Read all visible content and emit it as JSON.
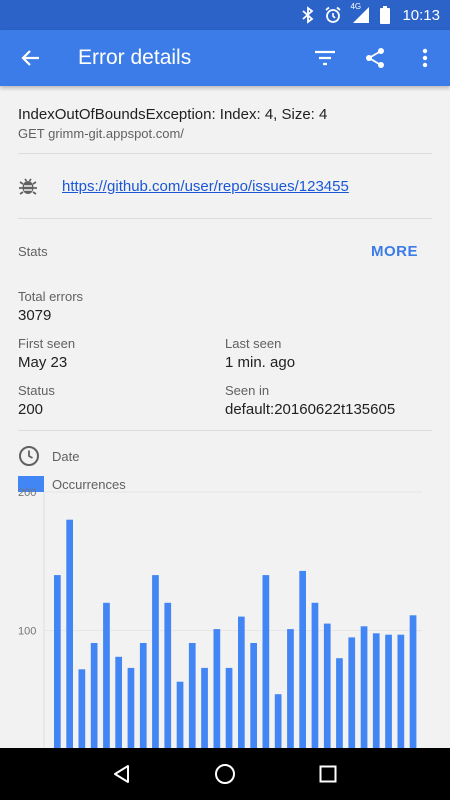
{
  "status_bar": {
    "time": "10:13",
    "network_label": "4G",
    "icons": [
      "bluetooth-icon",
      "alarm-icon",
      "signal-icon",
      "battery-icon"
    ]
  },
  "app_bar": {
    "title": "Error details",
    "icons": [
      "back-arrow-icon",
      "filter-icon",
      "share-icon",
      "more-vert-icon"
    ],
    "color": "#3b7ce8"
  },
  "error": {
    "exception": "IndexOutOfBoundsException: Index: 4, Size: 4",
    "request": "GET grimm-git.appspot.com/",
    "issue_link": "https://github.com/user/repo/issues/123455"
  },
  "stats": {
    "label": "Stats",
    "more_label": "MORE",
    "total_errors": {
      "label": "Total errors",
      "value": "3079"
    },
    "first_seen": {
      "label": "First seen",
      "value": "May 23"
    },
    "last_seen": {
      "label": "Last seen",
      "value": "1 min. ago"
    },
    "status": {
      "label": "Status",
      "value": "200"
    },
    "seen_in": {
      "label": "Seen in",
      "value": "default:20160622t135605"
    }
  },
  "chart_data": {
    "type": "bar",
    "xlabel": "Date",
    "series": [
      {
        "name": "Occurrences",
        "color": "#4285f4",
        "values": [
          140,
          180,
          72,
          91,
          120,
          81,
          73,
          91,
          140,
          120,
          63,
          91,
          73,
          101,
          73,
          110,
          91,
          140,
          54,
          101,
          143,
          120,
          105,
          80,
          95,
          103,
          98,
          97,
          97,
          111
        ]
      }
    ],
    "ylim": [
      0,
      200
    ],
    "yticks": [
      100,
      200
    ],
    "grid": true
  },
  "nav_bar": {
    "icons": [
      "back-triangle-icon",
      "home-circle-icon",
      "recents-square-icon"
    ]
  }
}
